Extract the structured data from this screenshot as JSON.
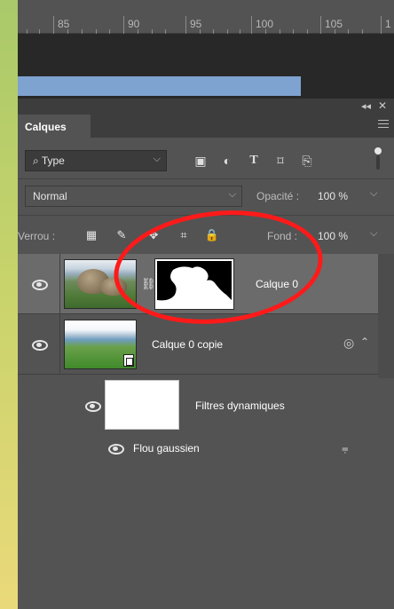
{
  "ruler": {
    "labels": [
      "85",
      "90",
      "95",
      "100",
      "105",
      "1"
    ]
  },
  "panel": {
    "tab_label": "Calques",
    "filter": {
      "selected": "Type"
    },
    "blend_mode": "Normal",
    "opacity_label": "Opacité :",
    "opacity_value": "100 %",
    "lock_label": "Verrou :",
    "fill_label": "Fond :",
    "fill_value": "100 %"
  },
  "layers": [
    {
      "name": "Calque 0",
      "selected": true,
      "has_mask": true,
      "visible": true
    },
    {
      "name": "Calque 0 copie",
      "selected": false,
      "smart_object": true,
      "visible": true
    }
  ],
  "smart_filters": {
    "label": "Filtres dynamiques",
    "items": [
      {
        "name": "Flou gaussien",
        "visible": true
      }
    ]
  },
  "colors": {
    "panel_bg": "#535353",
    "selected_row": "#6b6b6b",
    "annotation": "#ff1a1a"
  }
}
